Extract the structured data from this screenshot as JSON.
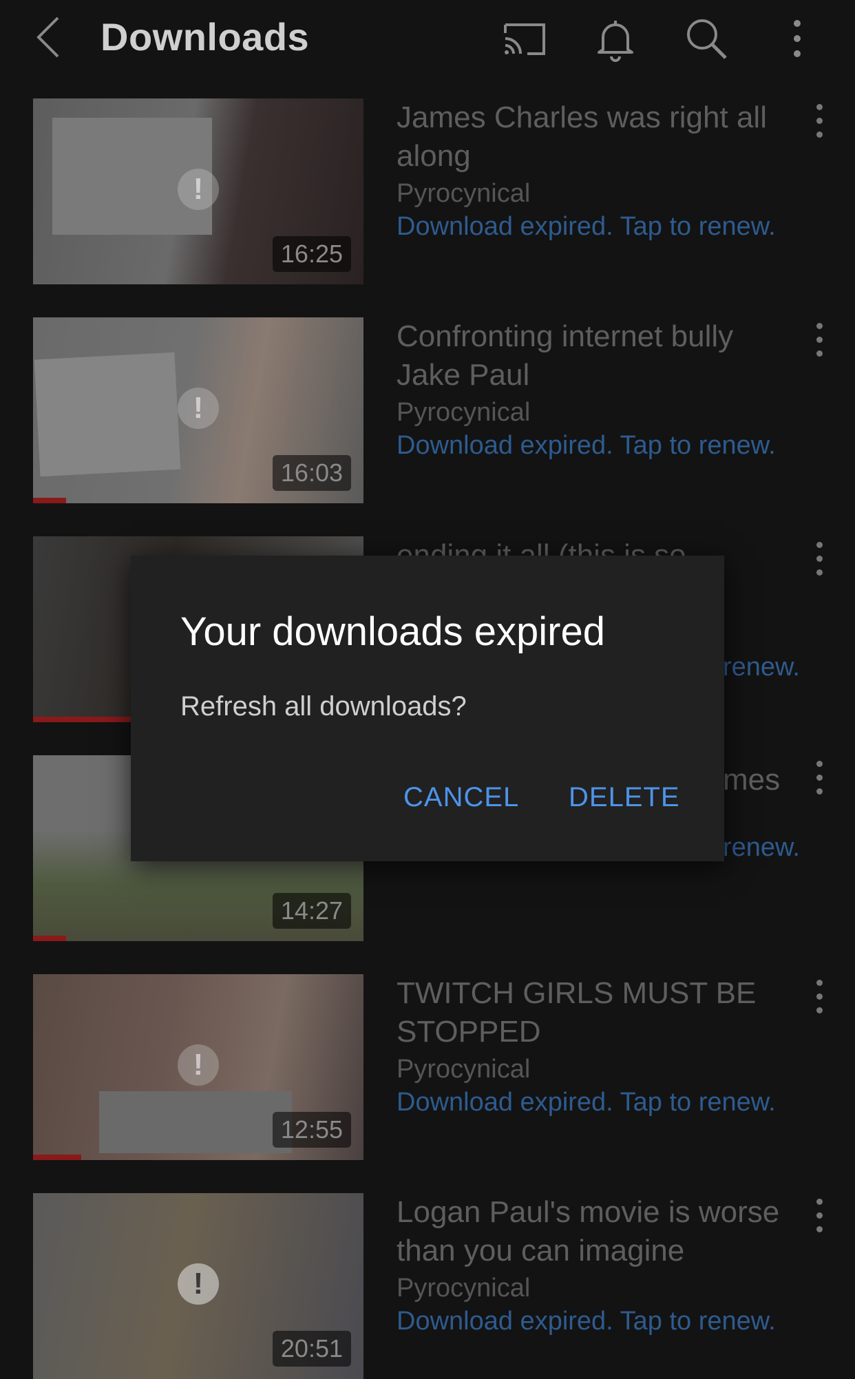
{
  "header": {
    "title": "Downloads",
    "icons": [
      "back-icon",
      "cast-icon",
      "bell-icon",
      "search-icon",
      "more-vert-icon"
    ]
  },
  "videos": [
    {
      "title": "James Charles was right all along",
      "channel": "Pyrocynical",
      "status": "Download expired. Tap to renew.",
      "duration": "16:25"
    },
    {
      "title": "Confronting internet bully Jake Paul",
      "channel": "Pyrocynical",
      "status": "Download expired. Tap to renew.",
      "duration": "16:03"
    },
    {
      "title": "ending it all (this is so",
      "channel": "",
      "status": "renew.",
      "duration": ""
    },
    {
      "title": "mes",
      "channel": "",
      "status": "renew.",
      "duration": "14:27"
    },
    {
      "title": "TWITCH GIRLS MUST BE STOPPED",
      "channel": "Pyrocynical",
      "status": "Download expired. Tap to renew.",
      "duration": "12:55"
    },
    {
      "title": "Logan Paul's movie is worse than you can imagine",
      "channel": "Pyrocynical",
      "status": "Download expired. Tap to renew.",
      "duration": "20:51"
    }
  ],
  "dialog": {
    "title": "Your downloads expired",
    "message": "Refresh all downloads?",
    "cancel_label": "CANCEL",
    "delete_label": "DELETE"
  },
  "colors": {
    "background": "#131313",
    "dialog_bg": "#212121",
    "accent_link": "#4d94ea"
  }
}
